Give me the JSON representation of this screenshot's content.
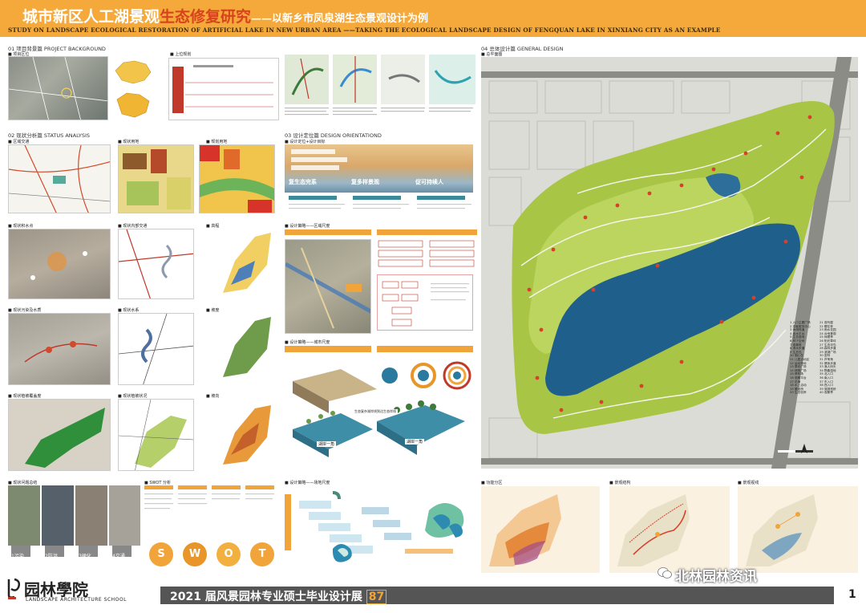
{
  "header": {
    "title_part1": "城市新区人工湖景观",
    "title_highlight": "生态修复研究",
    "title_sub": "——以新乡市凤泉湖生态景观设计为例",
    "subtitle_en": "STUDY ON LANDSCAPE ECOLOGICAL RESTORATION OF ARTIFICIAL LAKE IN NEW URBAN AREA ——TAKING THE ECOLOGICAL LANDSCAPE DESIGN OF FENGQUAN LAKE IN XINXIANG CITY AS AN EXAMPLE"
  },
  "sections": {
    "s01": "01 项目背景篇  PROJECT BACKGROUND",
    "s01_sub1": "■ 项目区位",
    "s01_sub2": "■ 上位规划",
    "s02": "02 现状分析篇  STATUS ANALYSIS",
    "s02_items": [
      "■ 区域交通",
      "■ 现状用地",
      "■ 规划用地",
      "■ 现状积水点",
      "■ 现状内部交通",
      "■ 高程",
      "■ 现状污染及水质",
      "■ 现状水系",
      "■ 坡度",
      "■ 现状植被覆盖度",
      "■ 现状植被状况",
      "■ 坡向",
      "■ 现状问题总结"
    ],
    "s03": "03 设计定位篇  DESIGN ORIENTATIOND",
    "s03_sub1": "■ 设计定位+设计目标",
    "s03_sub2": "■ 设计策略——区域尺度",
    "s03_sub3": "■ 设计策略——城市尺度",
    "s03_sub4": "■ 设计策略——场地尺度",
    "s04": "04 总体设计篇  GENERAL DESIGN",
    "s04_sub1": "■ 总平面图",
    "s04_sub2": "■ 功能分区",
    "s04_sub3": "■ 景观结构",
    "s04_sub4": "■ 景观视线",
    "swot_title": "■ SWOT 分析"
  },
  "orientation": {
    "slogans": [
      "复生态完系",
      "复多样景观",
      "促可持续人"
    ]
  },
  "problems": [
    "1污染",
    "2防洪",
    "3硬化",
    "4交通"
  ],
  "swot": [
    {
      "letter": "S",
      "color": "#f0a43a"
    },
    {
      "letter": "W",
      "color": "#e8962a"
    },
    {
      "letter": "O",
      "color": "#f2b040"
    },
    {
      "letter": "T",
      "color": "#f0a43a"
    }
  ],
  "strategy_labels": {
    "city_bar1": "目标一",
    "city_bar2": "目标二",
    "site_a": "湖岸一角",
    "site_b": "湖岸一角",
    "section_title": "生态复杂湖岸线到达生态岸线"
  },
  "legend_items": [
    "1 入口主题广场",
    "2 游客服务中心",
    "3 休闲栈道",
    "4 亲水平台",
    "5 生态湿地",
    "6 林下空间",
    "7 观景塔",
    "8 滨水步道",
    "9 生态岛",
    "10 湖心岛",
    "11 儿童活动区",
    "12 运动场地",
    "13 草坪广场",
    "14 林荫广场",
    "15 停车场",
    "16 观景平台",
    "17 花海",
    "18 水上活动",
    "19 景观桥",
    "20 生态驳岸",
    "21 观鸟屋",
    "22 樱花林",
    "23 雨水花园",
    "24 台地景观",
    "25 休憩亭",
    "26 阳光草坪",
    "27 生态浮岛",
    "28 森林步道",
    "29 滨湖广场",
    "30 密林",
    "31 芦苇荡",
    "32 健身步道",
    "33 渔人码头",
    "34 野趣湿地",
    "35 北入口",
    "36 南入口",
    "37 东入口",
    "38 西入口",
    "39 湖滨栈桥",
    "40 观景亭"
  ],
  "footer": {
    "logo_cn": "园林學院",
    "logo_en": "LANDSCAPE ARCHITECTURE SCHOOL",
    "exhibit": "2021 届风景园林专业硕士毕业设计展",
    "exhibit_num": "87",
    "page": "1",
    "watermark": "北林园林资讯"
  }
}
